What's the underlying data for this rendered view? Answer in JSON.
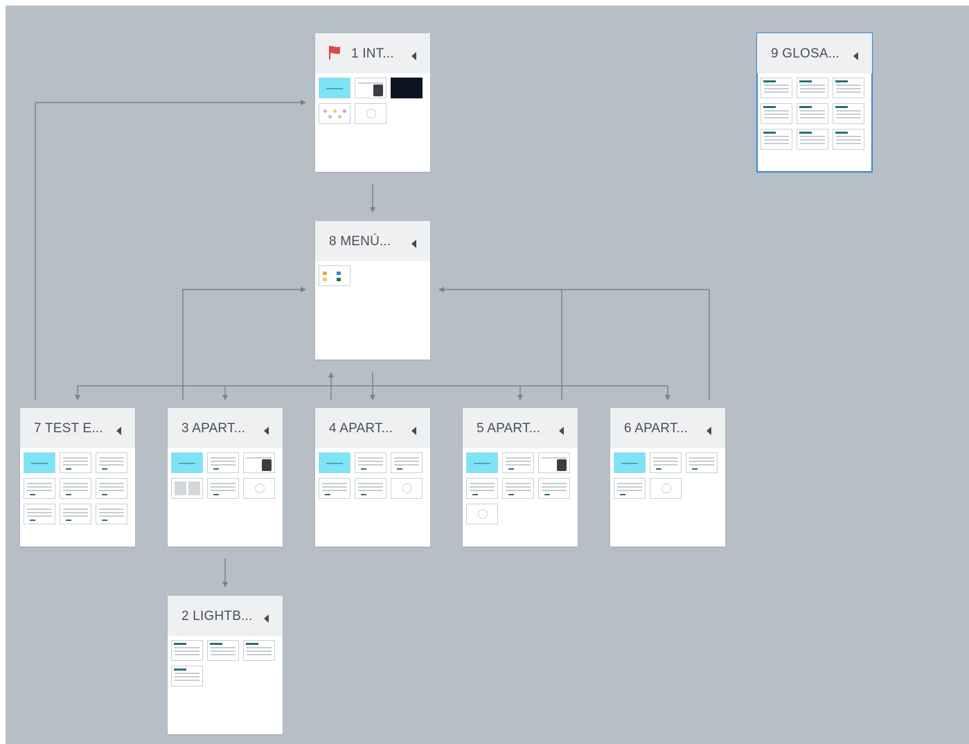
{
  "scenes": [
    {
      "id": "s1",
      "title": "1 INT...",
      "flag": true,
      "selected": false,
      "thumbs": [
        "blue-title",
        "person",
        "dark",
        "colorful",
        "empty"
      ]
    },
    {
      "id": "s9",
      "title": "9 GLOSA...",
      "flag": false,
      "selected": true,
      "thumbs": [
        "teal-header",
        "teal-header",
        "teal-header",
        "teal-header",
        "teal-header",
        "teal-header",
        "teal-header",
        "teal-header",
        "teal-header"
      ]
    },
    {
      "id": "s8",
      "title": "8 MENÚ...",
      "flag": false,
      "selected": false,
      "thumbs": [
        "menu"
      ]
    },
    {
      "id": "s7",
      "title": "7 TEST E...",
      "flag": false,
      "selected": false,
      "thumbs": [
        "cyan",
        "text",
        "text",
        "text",
        "text",
        "text",
        "text",
        "text",
        "text"
      ]
    },
    {
      "id": "s3",
      "title": "3 APART...",
      "flag": false,
      "selected": false,
      "thumbs": [
        "cyan",
        "text",
        "gallery",
        "grey-cols",
        "text",
        "empty"
      ]
    },
    {
      "id": "s4",
      "title": "4 APART...",
      "flag": false,
      "selected": false,
      "thumbs": [
        "cyan",
        "text",
        "text",
        "text",
        "text",
        "empty"
      ]
    },
    {
      "id": "s5",
      "title": "5 APART...",
      "flag": false,
      "selected": false,
      "thumbs": [
        "cyan",
        "text",
        "image",
        "text",
        "text",
        "text",
        "empty"
      ]
    },
    {
      "id": "s6",
      "title": "6 APART...",
      "flag": false,
      "selected": false,
      "thumbs": [
        "cyan",
        "text",
        "text",
        "text",
        "empty"
      ]
    },
    {
      "id": "s2",
      "title": "2 LIGHTB...",
      "flag": false,
      "selected": false,
      "thumbs": [
        "teal-header",
        "teal-header",
        "teal-header",
        "teal-header"
      ]
    }
  ],
  "icons": {
    "flag": "flag-icon",
    "collapse": "collapse-arrow-icon",
    "loading": "loading-spinner-icon"
  },
  "colors": {
    "canvas": "#b7bec6",
    "card": "#ffffff",
    "header": "#eef0f2",
    "connector": "#7b8288",
    "accent_cyan": "#7ee3f5",
    "selected_border": "#3a86d6",
    "flag_red": "#e04848"
  }
}
